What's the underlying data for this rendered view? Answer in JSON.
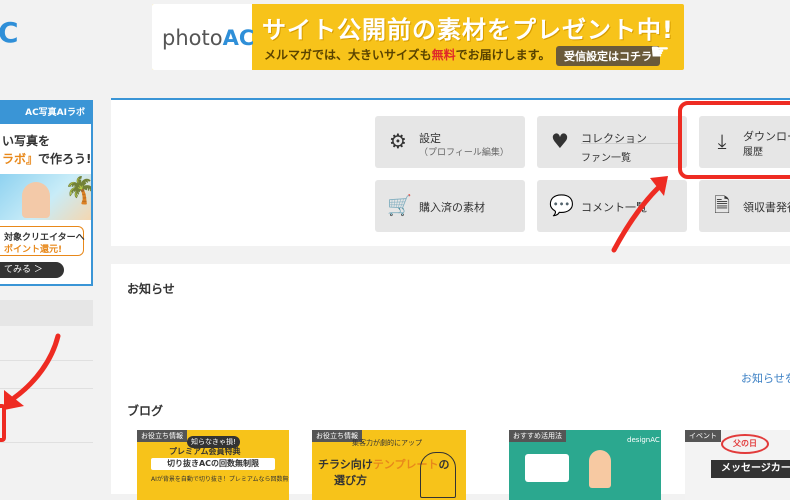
{
  "header": {
    "logo_fragment": "C",
    "banner": {
      "logo_photo": "photo",
      "logo_ac": "AC",
      "title": "サイト公開前の素材をプレゼント中!",
      "sub_prefix": "メルマガでは、大きいサイズも",
      "sub_emphasis": "無料",
      "sub_suffix": "でお届けします。",
      "cta": "受信設定はコチラ"
    }
  },
  "side_ad": {
    "head": "AC写真AIラボ",
    "line1": "い写真を",
    "line2_highlight": "ラボ』",
    "line2_suffix": "で作ろう!",
    "reward_line1": "対象クリエイターへ",
    "reward_line2": "ポイント還元!",
    "button": "てみる ＞"
  },
  "menu": {
    "settings": {
      "label": "設定",
      "sub": "（プロフィール編集）"
    },
    "collection": {
      "label": "コレクション",
      "sub": "ファン一覧"
    },
    "download": {
      "label": "ダウンロー",
      "sub": "履歴"
    },
    "purchased": {
      "label": "購入済の素材"
    },
    "comments": {
      "label": "コメント一覧"
    },
    "receipt": {
      "label": "領収書発行"
    }
  },
  "notices": {
    "title": "お知らせ",
    "more_link": "お知らせを"
  },
  "blog": {
    "title": "ブログ",
    "cards": [
      {
        "tag": "お役立ち情報",
        "line1": "知らなきゃ損!",
        "line2": "プレミアム会員特典",
        "line3": "切り抜きACの回数無制限",
        "line4": "AIが背景を自動で切り抜き！プレミアムなら回数無制限！"
      },
      {
        "tag": "お役立ち情報",
        "line1": "集客力が劇的にアップ",
        "line2_prefix": "チラシ向け",
        "line2_highlight": "テンプレート",
        "line2_suffix": "の",
        "line3": "選び方"
      },
      {
        "tag": "おすすめ活用法",
        "line1": "designAC"
      },
      {
        "tag": "イベント",
        "line1": "父の日",
        "line2": "メッセージカー"
      }
    ]
  }
}
